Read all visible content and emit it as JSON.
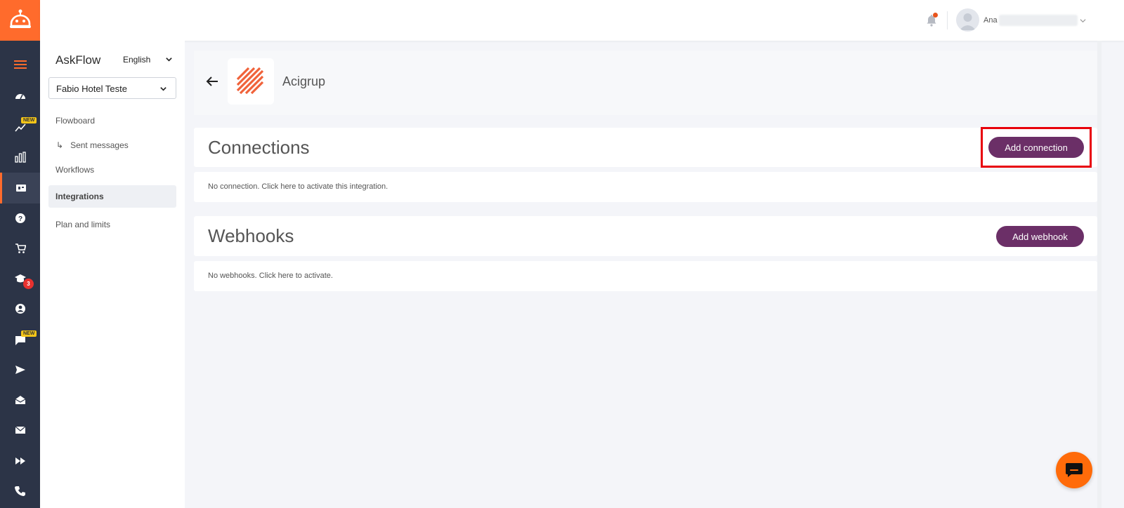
{
  "colors": {
    "brand_orange": "#ff6b2c",
    "rail_bg": "#2c3447",
    "button_purple": "#6b2f67",
    "highlight_red": "#e8000b"
  },
  "rail": {
    "items": [
      {
        "icon": "menu-icon",
        "active": false
      },
      {
        "icon": "dashboard-icon",
        "active": false
      },
      {
        "icon": "trend-icon",
        "badge": "NEW",
        "active": false
      },
      {
        "icon": "bar-chart-icon",
        "active": false
      },
      {
        "icon": "integrations-icon",
        "active": true
      },
      {
        "icon": "help-icon",
        "active": false
      },
      {
        "icon": "cart-icon",
        "active": false
      },
      {
        "icon": "academy-icon",
        "badge_count": "3",
        "active": false
      },
      {
        "icon": "account-icon",
        "active": false
      },
      {
        "icon": "chat-icon",
        "badge": "NEW",
        "active": false
      },
      {
        "icon": "send-icon",
        "active": false
      },
      {
        "icon": "inbox-icon",
        "active": false
      },
      {
        "icon": "mail-icon",
        "active": false
      },
      {
        "icon": "fast-forward-icon",
        "active": false
      },
      {
        "icon": "phone-icon",
        "active": false
      }
    ]
  },
  "topbar": {
    "user_name": "Ana"
  },
  "sidebar": {
    "title": "AskFlow",
    "language": "English",
    "hotel": "Fabio Hotel Teste",
    "nav": [
      {
        "label": "Flowboard"
      },
      {
        "label": "Sent messages"
      },
      {
        "label": "Workflows"
      },
      {
        "label": "Integrations"
      },
      {
        "label": "Plan and limits"
      }
    ]
  },
  "main": {
    "app_name": "Acigrup",
    "connections": {
      "title": "Connections",
      "button": "Add connection",
      "empty": "No connection. Click here to activate this integration."
    },
    "webhooks": {
      "title": "Webhooks",
      "button": "Add webhook",
      "empty": "No webhooks. Click here to activate."
    }
  }
}
